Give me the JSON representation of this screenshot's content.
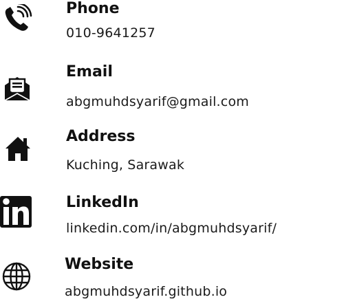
{
  "contacts": {
    "phone": {
      "label": "Phone",
      "value": "010-9641257",
      "icon": "phone-ringing-icon"
    },
    "email": {
      "label": "Email",
      "value": "abgmuhdsyarif@gmail.com",
      "icon": "envelope-icon"
    },
    "address": {
      "label": "Address",
      "value": "Kuching, Sarawak",
      "icon": "home-icon"
    },
    "linkedin": {
      "label": "LinkedIn",
      "value": "linkedin.com/in/abgmuhdsyarif/",
      "icon": "linkedin-icon"
    },
    "website": {
      "label": "Website",
      "value": "abgmuhdsyarif.github.io",
      "icon": "globe-icon"
    }
  },
  "colors": {
    "text": "#111111",
    "icon": "#111111"
  }
}
